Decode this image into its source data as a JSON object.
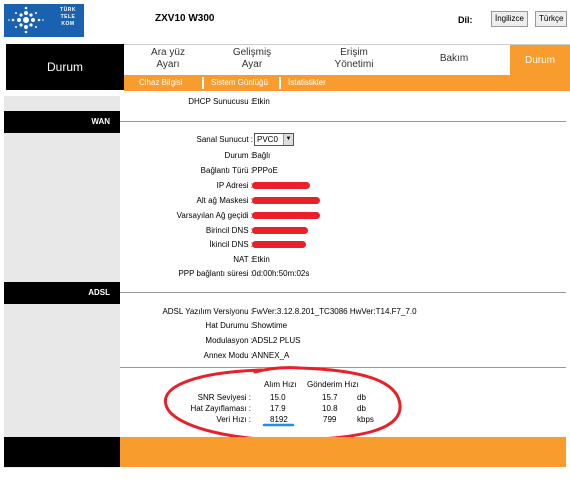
{
  "header": {
    "logo_text": [
      "TÜRK",
      "TELE",
      "KOM"
    ],
    "model": "ZXV10 W300",
    "lang_label": "Dil:",
    "lang_en": "İngilizce",
    "lang_tr": "Türkçe"
  },
  "nav": {
    "current": "Durum",
    "tabs": [
      {
        "line1": "Ara yüz",
        "line2": "Ayarı"
      },
      {
        "line1": "Gelişmiş",
        "line2": "Ayar"
      },
      {
        "line1": "Erişim",
        "line2": "Yönetimi"
      },
      {
        "line1": "Bakım",
        "line2": ""
      },
      {
        "line1": "Durum",
        "line2": ""
      }
    ],
    "subtabs": [
      "Cihaz Bilgisi",
      "Sistem Günlüğü",
      "İstatistikler"
    ]
  },
  "dhcp": {
    "label": "DHCP Sunucusu :",
    "value": "Etkin"
  },
  "wan": {
    "title": "WAN",
    "sanal_label": "Sanal Sunucut :",
    "sanal_value": "PVC0",
    "rows": [
      {
        "label": "Durum :",
        "value": "Bağlı"
      },
      {
        "label": "Bağlantı Türü :",
        "value": "PPPoE"
      },
      {
        "label": "IP Adresi :",
        "value": ""
      },
      {
        "label": "Alt ağ Maskesi :",
        "value": ""
      },
      {
        "label": "Varsayılan Ağ geçidi :",
        "value": ""
      },
      {
        "label": "Birincil DNS :",
        "value": ""
      },
      {
        "label": "İkincil DNS :",
        "value": ""
      },
      {
        "label": "NAT :",
        "value": "Etkin"
      },
      {
        "label": "PPP bağlantı süresi :",
        "value": "0d:00h:50m:02s"
      }
    ]
  },
  "adsl": {
    "title": "ADSL",
    "rows": [
      {
        "label": "ADSL Yazılım Versiyonu :",
        "value": "FwVer:3.12.8.201_TC3086 HwVer:T14.F7_7.0"
      },
      {
        "label": "Hat Durumu :",
        "value": "Showtime"
      },
      {
        "label": "Modulasyon :",
        "value": "ADSL2 PLUS"
      },
      {
        "label": "Annex Modu :",
        "value": "ANNEX_A"
      }
    ]
  },
  "snr": {
    "head_rx": "Alım Hızı",
    "head_tx": "Gönderim Hızı",
    "rows": [
      {
        "label": "SNR Seviyesi :",
        "rx": "15.0",
        "tx": "15.7",
        "unit": "db"
      },
      {
        "label": "Hat Zayıflaması :",
        "rx": "17.9",
        "tx": "10.8",
        "unit": "db"
      },
      {
        "label": "Veri Hızı :",
        "rx": "8192",
        "tx": "799",
        "unit": "kbps"
      }
    ]
  },
  "colors": {
    "orange": "#f79c2d",
    "logo_blue": "#1a61b0",
    "annotation_red": "#e8202a",
    "underline_blue": "#2a8be6"
  }
}
